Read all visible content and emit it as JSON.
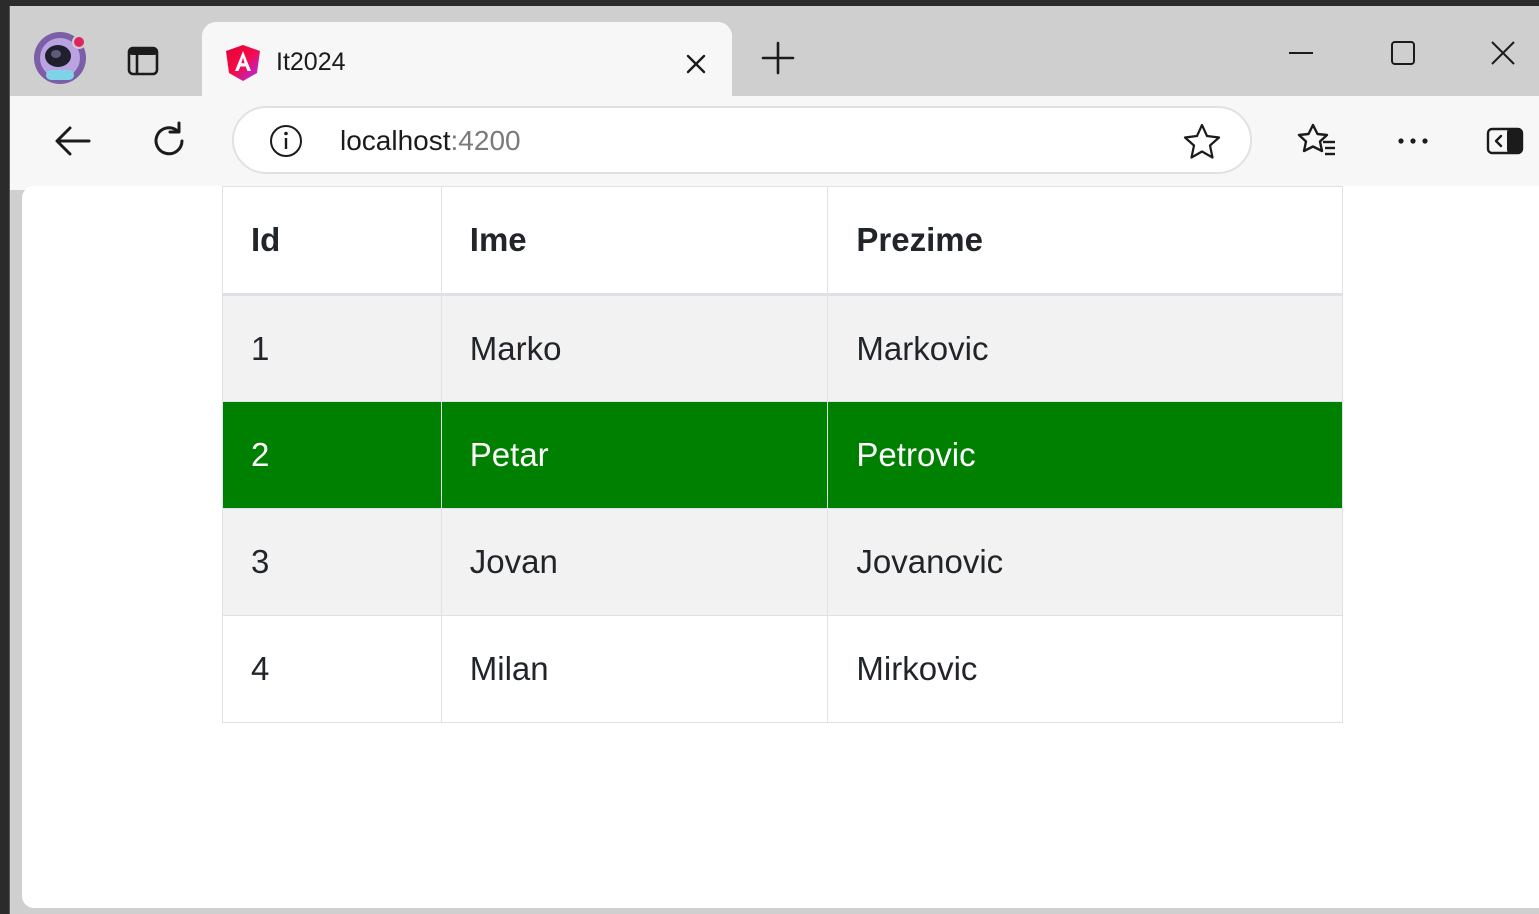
{
  "browser": {
    "tab": {
      "title": "It2024",
      "favicon": "angular-logo-icon"
    },
    "address": {
      "host": "localhost",
      "port": ":4200"
    },
    "icons": {
      "profile": "profile-avatar-icon",
      "workspaces": "workspaces-icon",
      "close_tab": "close-icon",
      "new_tab": "plus-icon",
      "minimize": "minimize-icon",
      "maximize": "maximize-icon",
      "close_window": "close-icon",
      "back": "back-arrow-icon",
      "refresh": "refresh-icon",
      "site_info": "info-icon",
      "add_favorite": "star-icon",
      "favorites": "favorites-icon",
      "more": "more-icon",
      "sidebar": "sidebar-icon"
    }
  },
  "table": {
    "headers": {
      "id": "Id",
      "ime": "Ime",
      "prezime": "Prezime"
    },
    "rows": [
      {
        "id": "1",
        "ime": "Marko",
        "prezime": "Markovic"
      },
      {
        "id": "2",
        "ime": "Petar",
        "prezime": "Petrovic"
      },
      {
        "id": "3",
        "ime": "Jovan",
        "prezime": "Jovanovic"
      },
      {
        "id": "4",
        "ime": "Milan",
        "prezime": "Mirkovic"
      }
    ],
    "selected_row_color": "#008000",
    "striped_row_color": "#f2f2f2"
  }
}
